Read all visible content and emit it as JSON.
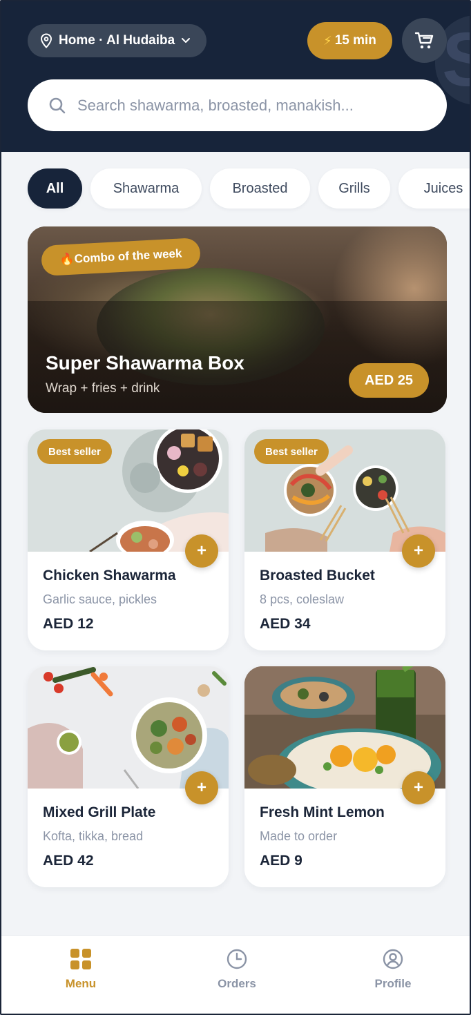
{
  "header": {
    "location_label": "Home · Al Hudaiba",
    "eta_label": "15 min",
    "decor_letter": "S"
  },
  "search": {
    "placeholder": "Search shawarma, broasted, manakish..."
  },
  "categories": [
    {
      "label": "All",
      "active": true
    },
    {
      "label": "Shawarma",
      "active": false
    },
    {
      "label": "Broasted",
      "active": false
    },
    {
      "label": "Grills",
      "active": false
    },
    {
      "label": "Juices",
      "active": false
    }
  ],
  "hero": {
    "badge": "🔥Combo of the week",
    "title": "Super Shawarma Box",
    "subtitle": "Wrap + fries + drink",
    "price": "AED 25"
  },
  "products": [
    {
      "name": "Chicken Shawarma",
      "desc": "Garlic sauce, pickles",
      "price": "AED 12",
      "badge": "Best seller"
    },
    {
      "name": "Broasted Bucket",
      "desc": "8 pcs, coleslaw",
      "price": "AED 34",
      "badge": "Best seller"
    },
    {
      "name": "Mixed Grill Plate",
      "desc": "Kofta, tikka, bread",
      "price": "AED 42",
      "badge": ""
    },
    {
      "name": "Fresh Mint Lemon",
      "desc": "Made to order",
      "price": "AED 9",
      "badge": ""
    }
  ],
  "add_label": "+",
  "nav": {
    "menu": "Menu",
    "orders": "Orders",
    "profile": "Profile"
  },
  "colors": {
    "brand_dark": "#17243a",
    "accent": "#c8922a",
    "background": "#f2f4f7"
  }
}
